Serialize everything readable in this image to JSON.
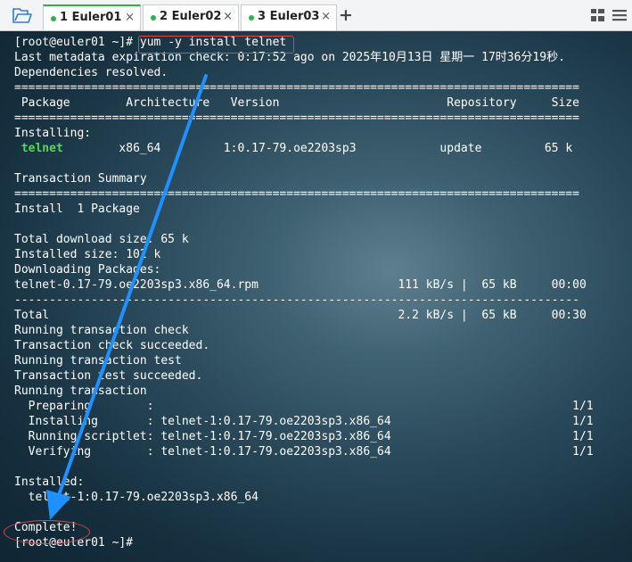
{
  "tabs": [
    {
      "label": "1 Euler01",
      "close": "×",
      "active": true
    },
    {
      "label": "2 Euler02",
      "close": "×",
      "active": false
    },
    {
      "label": "3 Euler03",
      "close": "×",
      "active": false
    }
  ],
  "toolbar": {
    "add_tab": "+",
    "open_icon": "folder-open-icon",
    "grid_icon": "grid-view-icon",
    "menu_icon": "hamburger-menu-icon"
  },
  "terminal": {
    "prompt": "[root@euler01 ~]# ",
    "command": "yum -y install telnet",
    "lines_a": [
      "Last metadata expiration check: 0:17:52 ago on 2025年10月13日 星期一 17时36分19秒.",
      "Dependencies resolved.",
      "=================================================================================",
      " Package        Architecture   Version                        Repository     Size",
      "================================================================================="
    ],
    "installing_header": "Installing:",
    "package_name": "telnet",
    "package_rest": "        x86_64         1:0.17-79.oe2203sp3            update         65 k",
    "lines_b": [
      "",
      "Transaction Summary",
      "=================================================================================",
      "Install  1 Package",
      "",
      "Total download size: 65 k",
      "Installed size: 102 k",
      "Downloading Packages:",
      "telnet-0.17-79.oe2203sp3.x86_64.rpm                    111 kB/s |  65 kB     00:00",
      "---------------------------------------------------------------------------------",
      "Total                                                  2.2 kB/s |  65 kB     00:30",
      "Running transaction check",
      "Transaction check succeeded.",
      "Running transaction test",
      "Transaction test succeeded.",
      "Running transaction",
      "  Preparing        :                                                            1/1",
      "  Installing       : telnet-1:0.17-79.oe2203sp3.x86_64                          1/1",
      "  Running scriptlet: telnet-1:0.17-79.oe2203sp3.x86_64                          1/1",
      "  Verifying        : telnet-1:0.17-79.oe2203sp3.x86_64                          1/1",
      "",
      "Installed:",
      "  telnet-1:0.17-79.oe2203sp3.x86_64",
      "",
      "Complete!",
      "[root@euler01 ~]# "
    ]
  },
  "colors": {
    "tab_active_accent": "#2bb34a",
    "annotation_red": "#d84a4a",
    "arrow_blue": "#1e90ff",
    "package_green": "#55d855"
  }
}
